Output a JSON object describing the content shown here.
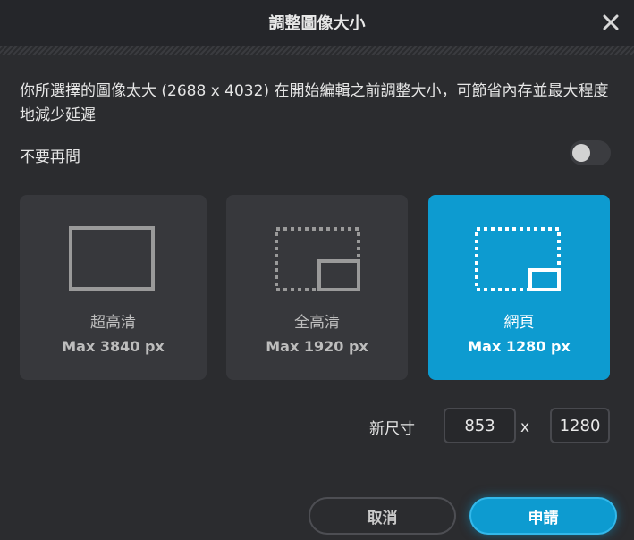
{
  "dialog": {
    "title": "調整圖像大小",
    "close_icon": "close-icon",
    "message": "你所選擇的圖像太大 (2688 x 4032) 在開始編輯之前調整大小，可節省內存並最大程度地減少延遲",
    "dont_ask_label": "不要再問",
    "dont_ask_enabled": false
  },
  "options": [
    {
      "name": "超高清",
      "max": "Max 3840 px",
      "icon": "frame-full-icon",
      "selected": false
    },
    {
      "name": "全高清",
      "max": "Max 1920 px",
      "icon": "frame-medium-icon",
      "selected": false
    },
    {
      "name": "網頁",
      "max": "Max 1280 px",
      "icon": "frame-small-icon",
      "selected": true
    }
  ],
  "size": {
    "label": "新尺寸",
    "width": "853",
    "separator": "x",
    "height": "1280"
  },
  "buttons": {
    "cancel": "取消",
    "apply": "申請"
  },
  "colors": {
    "background": "#2b2c2f",
    "accent": "#0d9bd0",
    "card": "#37383c"
  }
}
